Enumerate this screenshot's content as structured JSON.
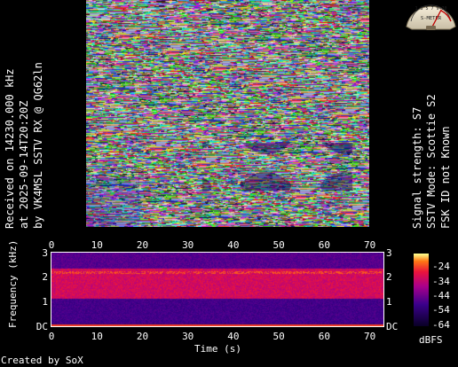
{
  "left_caption": [
    "Received on  14230.000 kHz",
    "at 2025-09-14T20:20Z",
    "by VK4MSL SSTV RX @ QG62ln"
  ],
  "right_caption": [
    "Signal strength: S7",
    "SSTV Mode: Scottie S2",
    "FSK ID not Known"
  ],
  "meter": {
    "label": "S-METER",
    "scale": "1 3 5 7 9+20",
    "level": "S7"
  },
  "spectrogram": {
    "x_ticks": [
      "0",
      "10",
      "20",
      "30",
      "40",
      "50",
      "60",
      "70"
    ],
    "y_ticks": [
      "3",
      "2",
      "1",
      "DC"
    ],
    "y_label": "Frequency (kHz)",
    "x_label": "Time (s)",
    "colorbar_ticks": [
      "-24",
      "-34",
      "-44",
      "-54",
      "-64"
    ],
    "colorbar_unit": "dBFS"
  },
  "footer": "Created by SoX",
  "colors": {
    "bg": "#000000",
    "text": "#ffffff",
    "noise_dark": "#28006a",
    "noise_hot": "#ff2a2a",
    "meter_needle": "#c00000"
  }
}
